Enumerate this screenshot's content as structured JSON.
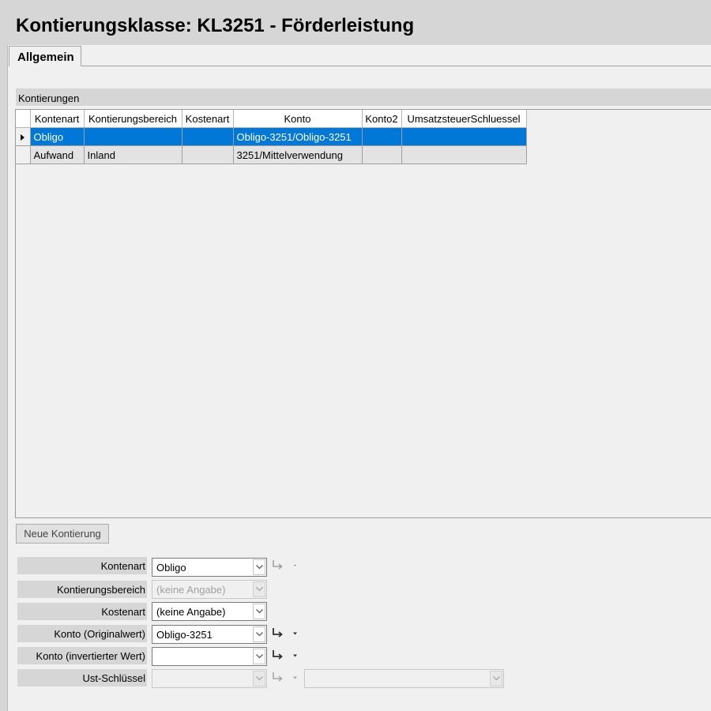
{
  "window": {
    "title": "Kontierungsklasse: KL3251 - Förderleistung"
  },
  "tabs": [
    {
      "label": "Allgemein",
      "active": true
    }
  ],
  "kontierungen": {
    "header": "Kontierungen",
    "columns": [
      "Kontenart",
      "Kontierungsbereich",
      "Kostenart",
      "Konto",
      "Konto2",
      "UmsatzsteuerSchluessel"
    ],
    "rows": [
      {
        "selected": true,
        "cells": [
          "Obligo",
          "",
          "",
          "Obligo-3251/Obligo-3251",
          "",
          ""
        ]
      },
      {
        "selected": false,
        "cells": [
          "Aufwand",
          "Inland",
          "",
          "3251/Mittelverwendung",
          "",
          ""
        ]
      }
    ]
  },
  "buttons": {
    "new_entry": "Neue Kontierung"
  },
  "form": {
    "fields": [
      {
        "label": "Kontenart",
        "value": "Obligo",
        "enabled": true
      },
      {
        "label": "Kontierungsbereich",
        "value": "(keine Angabe)",
        "enabled": false
      },
      {
        "label": "Kostenart",
        "value": "(keine Angabe)",
        "enabled": true
      },
      {
        "label": "Konto (Originalwert)",
        "value": "Obligo-3251",
        "enabled": true
      },
      {
        "label": "Konto (invertierter Wert)",
        "value": "",
        "enabled": true
      },
      {
        "label": "Ust-Schlüssel",
        "value": "",
        "enabled": false
      }
    ],
    "extra_combo_value": ""
  },
  "icons": {
    "row_selector": "row-pointer-icon",
    "goto": "goto-arrow-icon",
    "dropdown": "chevron-down-icon"
  },
  "colors": {
    "selection": "#0078d7",
    "header_band": "#d6d6d6",
    "background": "#f0f0f0"
  }
}
